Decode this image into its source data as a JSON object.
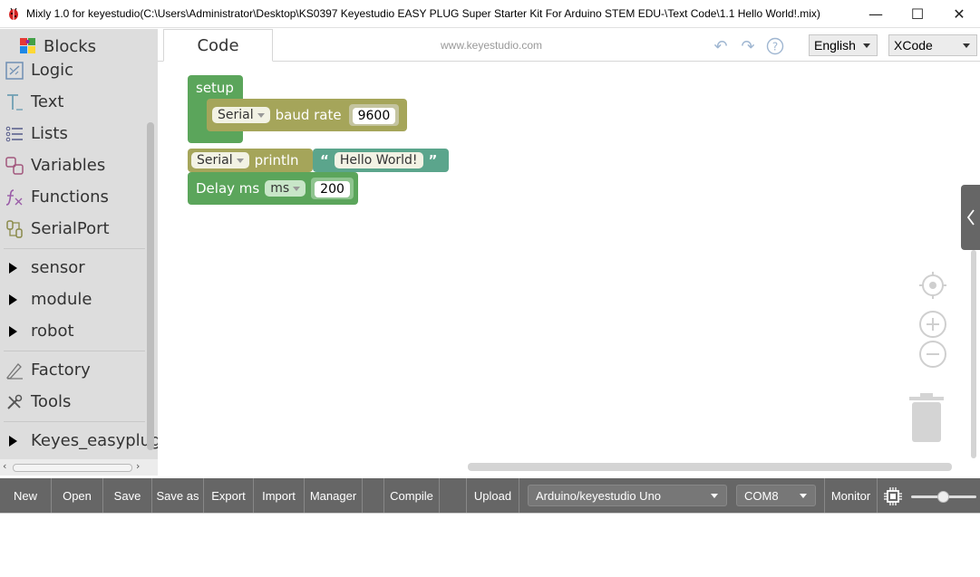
{
  "window": {
    "title": "Mixly 1.0 for keyestudio(C:\\Users\\Administrator\\Desktop\\KS0397 Keyestudio EASY PLUG Super Starter Kit For Arduino STEM EDU-\\Text Code\\1.1 Hello World!.mix)",
    "minimize": "—",
    "maximize": "☐",
    "close": "✕"
  },
  "header": {
    "tab_code": "Code",
    "site": "www.keyestudio.com",
    "language": "English",
    "theme": "XCode"
  },
  "toolbox": {
    "blocks_label": "Blocks",
    "categories": [
      {
        "label": "Logic",
        "icon": "logic-icon"
      },
      {
        "label": "Text",
        "icon": "text-icon"
      },
      {
        "label": "Lists",
        "icon": "list-icon"
      },
      {
        "label": "Variables",
        "icon": "variables-icon"
      },
      {
        "label": "Functions",
        "icon": "functions-icon"
      },
      {
        "label": "SerialPort",
        "icon": "serialport-icon"
      }
    ],
    "groups": [
      "sensor",
      "module",
      "robot"
    ],
    "extras": [
      {
        "label": "Factory",
        "icon": "factory-icon"
      },
      {
        "label": "Tools",
        "icon": "tools-icon"
      }
    ],
    "last_group": "Keyes_easyplug"
  },
  "blocks": {
    "setup": "setup",
    "serial1": "Serial",
    "baud_label": "baud rate",
    "baud_value": "9600",
    "serial2": "Serial",
    "println": "println",
    "quote_open": "“",
    "text_value": "Hello World!",
    "quote_close": "”",
    "delay_label": "Delay ms",
    "delay_unit": "ms",
    "delay_value": "200"
  },
  "bottombar": {
    "buttons": [
      "New",
      "Open",
      "Save",
      "Save as",
      "Export",
      "Import",
      "Manager",
      "Compile",
      "Upload"
    ],
    "board": "Arduino/keyestudio Uno",
    "port": "COM8",
    "monitor": "Monitor"
  }
}
